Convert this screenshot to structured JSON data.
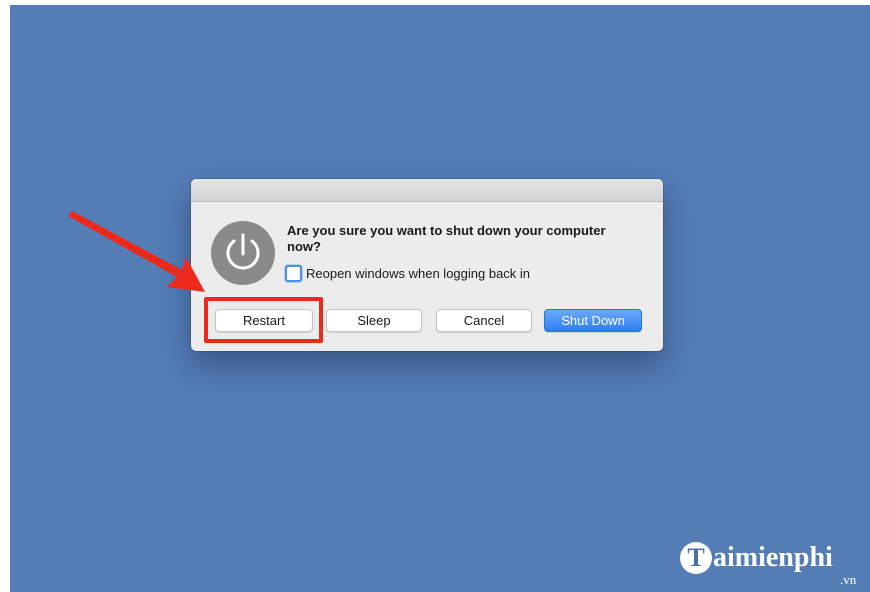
{
  "dialog": {
    "message": "Are you sure you want to shut down your computer now?",
    "reopen_label": "Reopen windows when logging back in",
    "reopen_checked": false,
    "power_icon": "power-icon",
    "buttons": {
      "restart": "Restart",
      "sleep": "Sleep",
      "cancel": "Cancel",
      "shutdown": "Shut Down"
    }
  },
  "annotation": {
    "highlight_color": "#ec2a1c",
    "arrow_icon": "red-arrow-icon"
  },
  "watermark": {
    "badge": "T",
    "text": "aimienphi",
    "domain": ".vn"
  },
  "colors": {
    "desktop": "#547db6",
    "dialog_bg": "#ececec",
    "primary_button": "#2f7ef1"
  }
}
